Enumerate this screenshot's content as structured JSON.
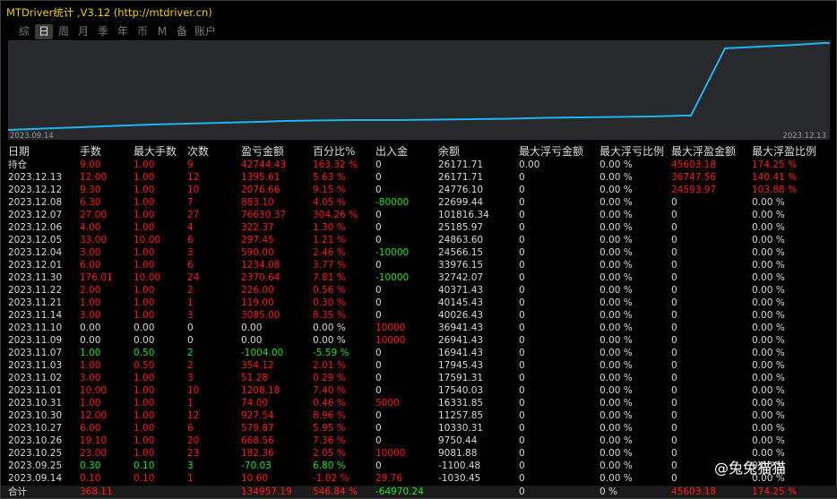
{
  "window": {
    "title": "MTDriver统计 ,V3.12 (http://mtdriver.cn)"
  },
  "tabs": [
    "综",
    "日",
    "周",
    "月",
    "季",
    "年",
    "币",
    "M",
    "备",
    "账户"
  ],
  "active_tab": "日",
  "equity_chart": {
    "start_date": "2023.09.14",
    "end_date": "2023.12.13",
    "line_color": "#1eb4f0"
  },
  "columns": [
    "日期",
    "手数",
    "最大手数",
    "次数",
    "盈亏金额",
    "百分比%",
    "出入金",
    "余额",
    "最大浮亏金额",
    "最大浮亏比例",
    "最大浮盈金额",
    "最大浮盈比例"
  ],
  "rows": [
    {
      "c": [
        "持仓",
        "9.00",
        "1.00",
        "9",
        "42744.43",
        "163.32 %",
        "0",
        "26171.71",
        "0.00",
        "0.00 %",
        "45603.18",
        "174.25 %"
      ],
      "k": [
        "w",
        "r",
        "r",
        "r",
        "r",
        "r",
        "w",
        "w",
        "w",
        "w",
        "r",
        "r"
      ]
    },
    {
      "c": [
        "2023.12.13",
        "12.00",
        "1.00",
        "12",
        "1395.61",
        "5.63 %",
        "0",
        "26171.71",
        "0",
        "0.00 %",
        "36747.56",
        "140.41 %"
      ],
      "k": [
        "w",
        "r",
        "r",
        "r",
        "r",
        "r",
        "w",
        "w",
        "w",
        "w",
        "r",
        "r"
      ]
    },
    {
      "c": [
        "2023.12.12",
        "9.30",
        "1.00",
        "10",
        "2076.66",
        "9.15 %",
        "0",
        "24776.10",
        "0",
        "0.00 %",
        "24593.97",
        "103.88 %"
      ],
      "k": [
        "w",
        "r",
        "r",
        "r",
        "r",
        "r",
        "w",
        "w",
        "w",
        "w",
        "r",
        "r"
      ]
    },
    {
      "c": [
        "2023.12.08",
        "6.30",
        "1.00",
        "7",
        "883.10",
        "4.05 %",
        "-80000",
        "22699.44",
        "0",
        "0.00 %",
        "0",
        "0.00 %"
      ],
      "k": [
        "w",
        "r",
        "r",
        "r",
        "r",
        "r",
        "g",
        "w",
        "w",
        "w",
        "w",
        "w"
      ]
    },
    {
      "c": [
        "2023.12.07",
        "27.00",
        "1.00",
        "27",
        "76630.37",
        "304.26 %",
        "0",
        "101816.34",
        "0",
        "0.00 %",
        "0",
        "0.00 %"
      ],
      "k": [
        "w",
        "r",
        "r",
        "r",
        "r",
        "r",
        "w",
        "w",
        "w",
        "w",
        "w",
        "w"
      ]
    },
    {
      "c": [
        "2023.12.06",
        "4.00",
        "1.00",
        "4",
        "322.37",
        "1.30 %",
        "0",
        "25185.97",
        "0",
        "0.00 %",
        "0",
        "0.00 %"
      ],
      "k": [
        "w",
        "r",
        "r",
        "r",
        "r",
        "r",
        "w",
        "w",
        "w",
        "w",
        "w",
        "w"
      ]
    },
    {
      "c": [
        "2023.12.05",
        "33.00",
        "10.00",
        "6",
        "297.45",
        "1.21 %",
        "0",
        "24863.60",
        "0",
        "0.00 %",
        "0",
        "0.00 %"
      ],
      "k": [
        "w",
        "r",
        "r",
        "r",
        "r",
        "r",
        "w",
        "w",
        "w",
        "w",
        "w",
        "w"
      ]
    },
    {
      "c": [
        "2023.12.04",
        "3.00",
        "1.00",
        "3",
        "590.00",
        "2.46 %",
        "-10000",
        "24566.15",
        "0",
        "0.00 %",
        "0",
        "0.00 %"
      ],
      "k": [
        "w",
        "r",
        "r",
        "r",
        "r",
        "r",
        "g",
        "w",
        "w",
        "w",
        "w",
        "w"
      ]
    },
    {
      "c": [
        "2023.12.01",
        "6.00",
        "1.00",
        "6",
        "1234.08",
        "3.77 %",
        "0",
        "33976.15",
        "0",
        "0.00 %",
        "0",
        "0.00 %"
      ],
      "k": [
        "w",
        "r",
        "r",
        "r",
        "r",
        "r",
        "w",
        "w",
        "w",
        "w",
        "w",
        "w"
      ]
    },
    {
      "c": [
        "2023.11.30",
        "176.01",
        "10.00",
        "24",
        "2370.64",
        "7.81 %",
        "-10000",
        "32742.07",
        "0",
        "0.00 %",
        "0",
        "0.00 %"
      ],
      "k": [
        "w",
        "r",
        "r",
        "r",
        "r",
        "r",
        "g",
        "w",
        "w",
        "w",
        "w",
        "w"
      ]
    },
    {
      "c": [
        "2023.11.22",
        "2.00",
        "1.00",
        "2",
        "226.00",
        "0.56 %",
        "0",
        "40371.43",
        "0",
        "0.00 %",
        "0",
        "0.00 %"
      ],
      "k": [
        "w",
        "r",
        "r",
        "r",
        "r",
        "r",
        "w",
        "w",
        "w",
        "w",
        "w",
        "w"
      ]
    },
    {
      "c": [
        "2023.11.21",
        "1.00",
        "1.00",
        "1",
        "119.00",
        "0.30 %",
        "0",
        "40145.43",
        "0",
        "0.00 %",
        "0",
        "0.00 %"
      ],
      "k": [
        "w",
        "r",
        "r",
        "r",
        "r",
        "r",
        "w",
        "w",
        "w",
        "w",
        "w",
        "w"
      ]
    },
    {
      "c": [
        "2023.11.14",
        "3.00",
        "1.00",
        "3",
        "3085.00",
        "8.35 %",
        "0",
        "40026.43",
        "0",
        "0.00 %",
        "0",
        "0.00 %"
      ],
      "k": [
        "w",
        "r",
        "r",
        "r",
        "r",
        "r",
        "w",
        "w",
        "w",
        "w",
        "w",
        "w"
      ]
    },
    {
      "c": [
        "2023.11.10",
        "0.00",
        "0.00",
        "0",
        "0.00",
        "0.00 %",
        "10000",
        "36941.43",
        "0",
        "0.00 %",
        "0",
        "0.00 %"
      ],
      "k": [
        "w",
        "w",
        "w",
        "w",
        "w",
        "w",
        "r",
        "w",
        "w",
        "w",
        "w",
        "w"
      ]
    },
    {
      "c": [
        "2023.11.09",
        "0.00",
        "0.00",
        "0",
        "0.00",
        "0.00 %",
        "10000",
        "26941.43",
        "0",
        "0.00 %",
        "0",
        "0.00 %"
      ],
      "k": [
        "w",
        "w",
        "w",
        "w",
        "w",
        "w",
        "r",
        "w",
        "w",
        "w",
        "w",
        "w"
      ]
    },
    {
      "c": [
        "2023.11.07",
        "1.00",
        "0.50",
        "2",
        "-1004.00",
        "-5.59 %",
        "0",
        "16941.43",
        "0",
        "0.00 %",
        "0",
        "0.00 %"
      ],
      "k": [
        "w",
        "g",
        "g",
        "g",
        "g",
        "g",
        "w",
        "w",
        "w",
        "w",
        "w",
        "w"
      ]
    },
    {
      "c": [
        "2023.11.03",
        "1.00",
        "0.50",
        "2",
        "354.12",
        "2.01 %",
        "0",
        "17945.43",
        "0",
        "0.00 %",
        "0",
        "0.00 %"
      ],
      "k": [
        "w",
        "r",
        "r",
        "r",
        "r",
        "r",
        "w",
        "w",
        "w",
        "w",
        "w",
        "w"
      ]
    },
    {
      "c": [
        "2023.11.02",
        "3.00",
        "1.00",
        "3",
        "51.28",
        "0.29 %",
        "0",
        "17591.31",
        "0",
        "0.00 %",
        "0",
        "0.00 %"
      ],
      "k": [
        "w",
        "r",
        "r",
        "r",
        "r",
        "r",
        "w",
        "w",
        "w",
        "w",
        "w",
        "w"
      ]
    },
    {
      "c": [
        "2023.11.01",
        "10.00",
        "1.00",
        "10",
        "1208.18",
        "7.40 %",
        "0",
        "17540.03",
        "0",
        "0.00 %",
        "0",
        "0.00 %"
      ],
      "k": [
        "w",
        "r",
        "r",
        "r",
        "r",
        "r",
        "w",
        "w",
        "w",
        "w",
        "w",
        "w"
      ]
    },
    {
      "c": [
        "2023.10.31",
        "1.00",
        "1.00",
        "1",
        "74.00",
        "0.46 %",
        "5000",
        "16331.85",
        "0",
        "0.00 %",
        "0",
        "0.00 %"
      ],
      "k": [
        "w",
        "r",
        "r",
        "r",
        "r",
        "r",
        "r",
        "w",
        "w",
        "w",
        "w",
        "w"
      ]
    },
    {
      "c": [
        "2023.10.30",
        "12.00",
        "1.00",
        "12",
        "927.54",
        "8.96 %",
        "0",
        "11257.85",
        "0",
        "0.00 %",
        "0",
        "0.00 %"
      ],
      "k": [
        "w",
        "r",
        "r",
        "r",
        "r",
        "r",
        "w",
        "w",
        "w",
        "w",
        "w",
        "w"
      ]
    },
    {
      "c": [
        "2023.10.27",
        "6.00",
        "1.00",
        "6",
        "579.87",
        "5.95 %",
        "0",
        "10330.31",
        "0",
        "0.00 %",
        "0",
        "0.00 %"
      ],
      "k": [
        "w",
        "r",
        "r",
        "r",
        "r",
        "r",
        "w",
        "w",
        "w",
        "w",
        "w",
        "w"
      ]
    },
    {
      "c": [
        "2023.10.26",
        "19.10",
        "1.00",
        "20",
        "668.56",
        "7.36 %",
        "0",
        "9750.44",
        "0",
        "0.00 %",
        "0",
        "0.00 %"
      ],
      "k": [
        "w",
        "r",
        "r",
        "r",
        "r",
        "r",
        "w",
        "w",
        "w",
        "w",
        "w",
        "w"
      ]
    },
    {
      "c": [
        "2023.10.25",
        "23.00",
        "1.00",
        "23",
        "182.36",
        "2.05 %",
        "10000",
        "9081.88",
        "0",
        "0.00 %",
        "0",
        "0.00 %"
      ],
      "k": [
        "w",
        "r",
        "r",
        "r",
        "r",
        "r",
        "r",
        "w",
        "w",
        "w",
        "w",
        "w"
      ]
    },
    {
      "c": [
        "2023.09.25",
        "0.30",
        "0.10",
        "3",
        "-70.03",
        "6.80 %",
        "0",
        "-1100.48",
        "0",
        "0.00 %",
        "0",
        "0.00 %"
      ],
      "k": [
        "w",
        "g",
        "g",
        "g",
        "g",
        "g",
        "w",
        "w",
        "w",
        "w",
        "w",
        "w"
      ]
    },
    {
      "c": [
        "2023.09.14",
        "0.10",
        "0.10",
        "1",
        "10.60",
        "-1.02 %",
        "29.76",
        "-1030.45",
        "0",
        "0.00 %",
        "0",
        "0.00 %"
      ],
      "k": [
        "w",
        "r",
        "r",
        "r",
        "r",
        "r",
        "r",
        "w",
        "w",
        "w",
        "w",
        "w"
      ]
    }
  ],
  "total": {
    "c": [
      "合计",
      "368.11",
      "",
      "",
      "134957.19",
      "546.84 %",
      "-64970.24",
      "",
      "0",
      "0 %",
      "45603.18",
      "174.25 %"
    ],
    "k": [
      "w",
      "r",
      "r",
      "r",
      "r",
      "r",
      "g",
      "w",
      "w",
      "w",
      "r",
      "r"
    ]
  },
  "watermark": "@兔兔猫猫"
}
